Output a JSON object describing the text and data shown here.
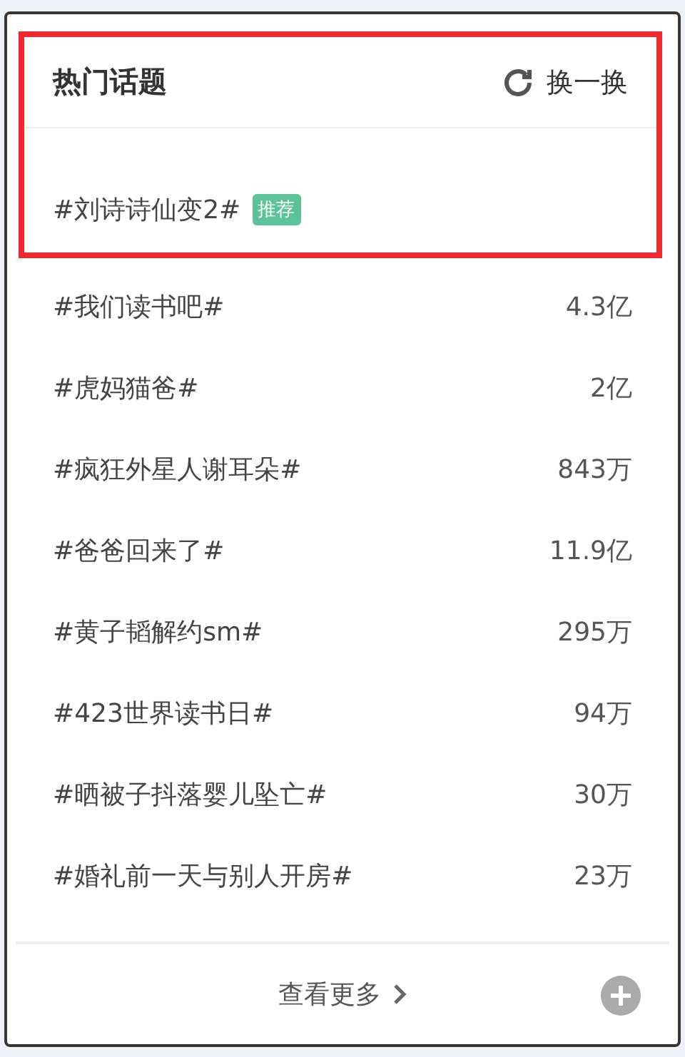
{
  "panel": {
    "title": "热门话题",
    "refresh": "换一换"
  },
  "featured": {
    "topic": "#刘诗诗仙变2#",
    "badge": "推荐",
    "highlighted": true
  },
  "topics": [
    {
      "topic": "#我们读书吧#",
      "count": "4.3亿"
    },
    {
      "topic": "#虎妈猫爸#",
      "count": "2亿"
    },
    {
      "topic": "#疯狂外星人谢耳朵#",
      "count": "843万"
    },
    {
      "topic": "#爸爸回来了#",
      "count": "11.9亿"
    },
    {
      "topic": "#黄子韬解约sm#",
      "count": "295万"
    },
    {
      "topic": "#423世界读书日#",
      "count": "94万"
    },
    {
      "topic": "#晒被子抖落婴儿坠亡#",
      "count": "30万"
    },
    {
      "topic": "#婚礼前一天与别人开房#",
      "count": "23万"
    }
  ],
  "footer": {
    "more": "查看更多"
  }
}
